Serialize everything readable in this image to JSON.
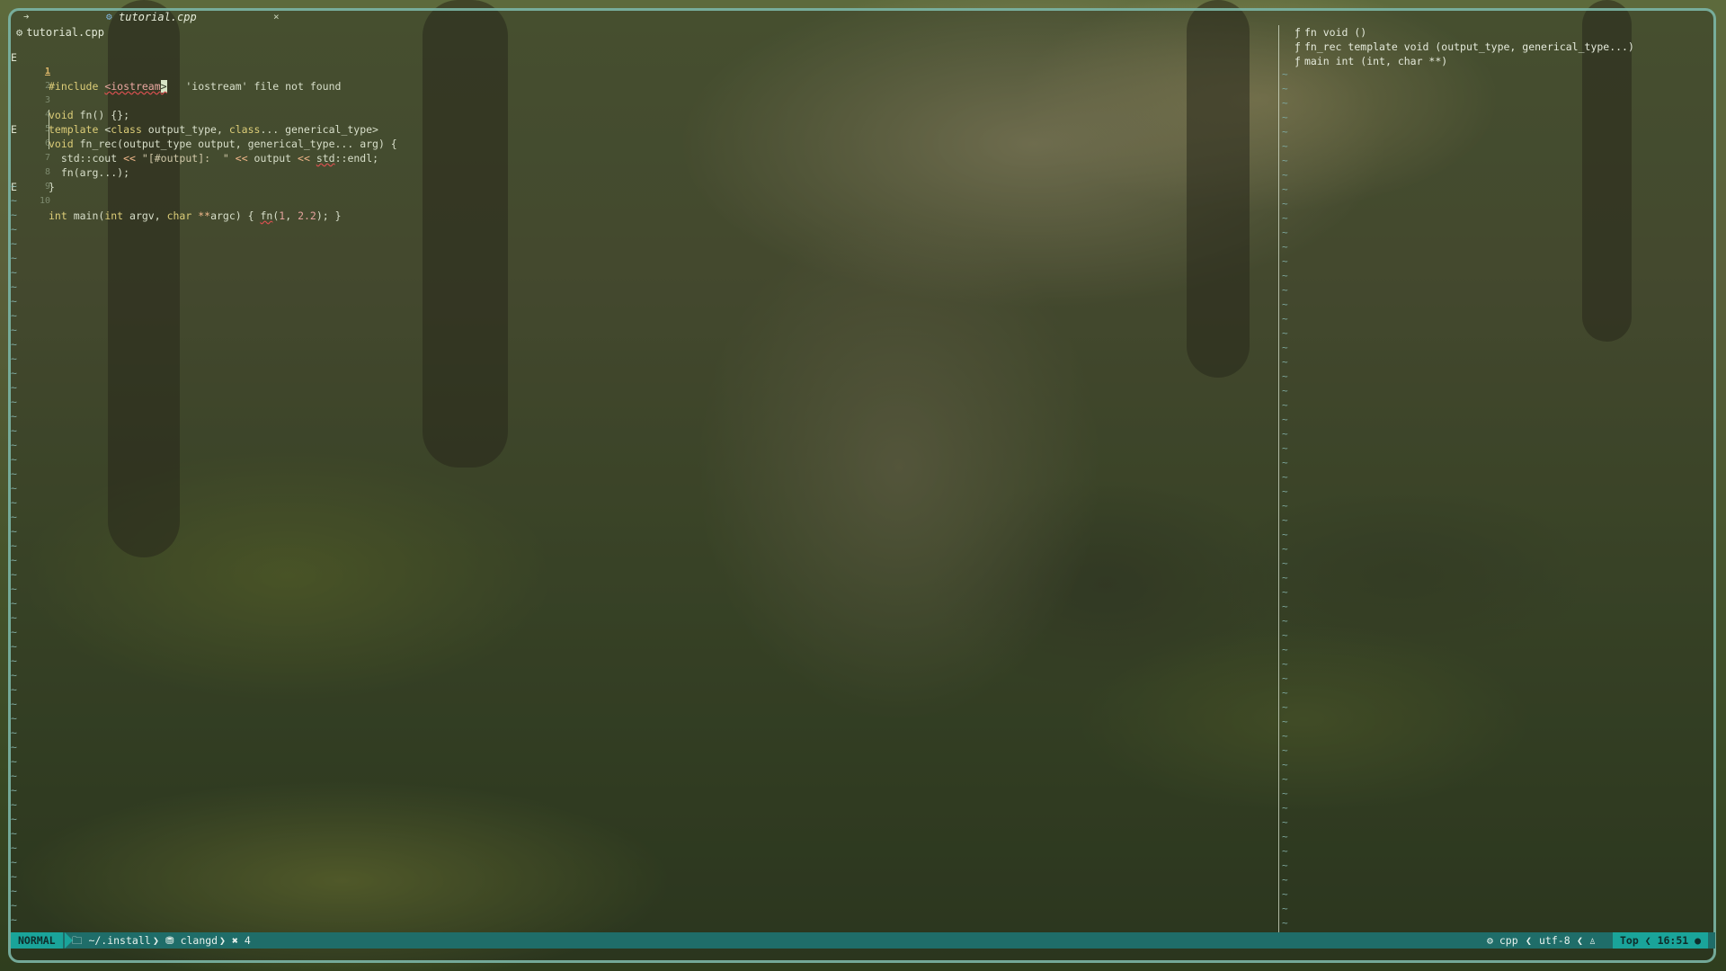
{
  "tabs": {
    "arrow": "➔",
    "active_file": "tutorial.cpp",
    "close": "×"
  },
  "winbar": {
    "filename": "tutorial.cpp"
  },
  "editor": {
    "lines": [
      {
        "num": "1",
        "sign": "E"
      },
      {
        "num": "2",
        "sign": ""
      },
      {
        "num": "3",
        "sign": ""
      },
      {
        "num": "4",
        "sign": ""
      },
      {
        "num": "5",
        "sign": ""
      },
      {
        "num": "6",
        "sign": "E"
      },
      {
        "num": "7",
        "sign": ""
      },
      {
        "num": "8",
        "sign": ""
      },
      {
        "num": "9",
        "sign": ""
      },
      {
        "num": "10",
        "sign": "E"
      }
    ],
    "diagnostic": "'iostream' file not found"
  },
  "outline": {
    "items": [
      {
        "name": "fn",
        "detail": "void ()"
      },
      {
        "name": "fn_rec",
        "detail": "template void (output_type, generical_type...)"
      },
      {
        "name": "main",
        "detail": "int (int, char **)"
      }
    ]
  },
  "statusline": {
    "mode": "NORMAL",
    "cwd": "~/.install",
    "lsp": "clangd",
    "diagnostics_count": "4",
    "filetype": "cpp",
    "encoding": "utf-8",
    "position": "Top",
    "time": "16:51"
  },
  "icons": {
    "folder": "folder-icon",
    "lsp": "server-icon",
    "error": "error-icon",
    "gear": "gear-icon",
    "function": "function-icon",
    "penguin": "linux-icon"
  },
  "colors": {
    "status_accent": "#1aa49a",
    "status_bg": "#1f6d69",
    "error_underline": "#d85050"
  }
}
